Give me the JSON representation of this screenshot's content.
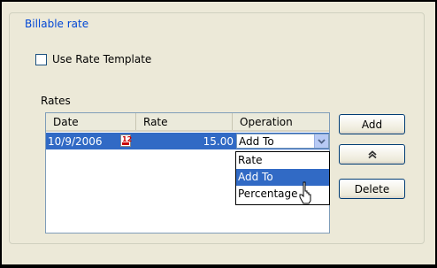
{
  "groupbox": {
    "title": "Billable rate"
  },
  "use_template": {
    "label": "Use Rate Template",
    "checked": false
  },
  "rates": {
    "label": "Rates",
    "columns": [
      "Date",
      "Rate",
      "Operation"
    ],
    "rows": [
      {
        "date": "10/9/2006",
        "rate": "15.00",
        "operation": "Add To"
      }
    ]
  },
  "dropdown": {
    "options": [
      "Rate",
      "Add To",
      "Percentage"
    ],
    "selected": "Add To"
  },
  "buttons": {
    "add": "Add",
    "up": "^",
    "delete": "Delete"
  },
  "colors": {
    "selection": "#316ac5",
    "groupbox_title": "#0046d5"
  }
}
